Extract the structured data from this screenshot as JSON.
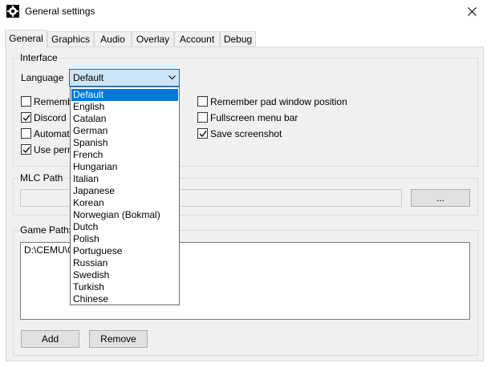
{
  "window": {
    "title": "General settings"
  },
  "tabs": [
    "General",
    "Graphics",
    "Audio",
    "Overlay",
    "Account",
    "Debug"
  ],
  "interface": {
    "legend": "Interface",
    "language_label": "Language",
    "language_value": "Default",
    "checkboxes_left": [
      {
        "label": "Rememb",
        "checked": false
      },
      {
        "label": "Discord P",
        "checked": true
      },
      {
        "label": "Automat",
        "checked": false
      },
      {
        "label": "Use perm",
        "checked": true
      }
    ],
    "checkboxes_right": [
      {
        "label": "Remember pad window position",
        "checked": false
      },
      {
        "label": "Fullscreen menu bar",
        "checked": false
      },
      {
        "label": "Save screenshot",
        "checked": true
      }
    ]
  },
  "mlc": {
    "legend": "MLC Path",
    "browse_label": "..."
  },
  "game_paths": {
    "legend": "Game Paths",
    "path_item": "D:\\CEMU\\G",
    "add_label": "Add",
    "remove_label": "Remove"
  },
  "language_options": [
    "Default",
    "English",
    "Catalan",
    "German",
    "Spanish",
    "French",
    "Hungarian",
    "Italian",
    "Japanese",
    "Korean",
    "Norwegian (Bokmal)",
    "Dutch",
    "Polish",
    "Portuguese",
    "Russian",
    "Swedish",
    "Turkish",
    "Chinese"
  ],
  "icons": {
    "app": "gear-icon",
    "close": "close-icon",
    "combo": "chevron-down-icon",
    "check": "checkmark-icon"
  },
  "colors": {
    "selection": "#0078d7",
    "combo_bg": "#cce4f7",
    "panel": "#f0f0f0"
  }
}
